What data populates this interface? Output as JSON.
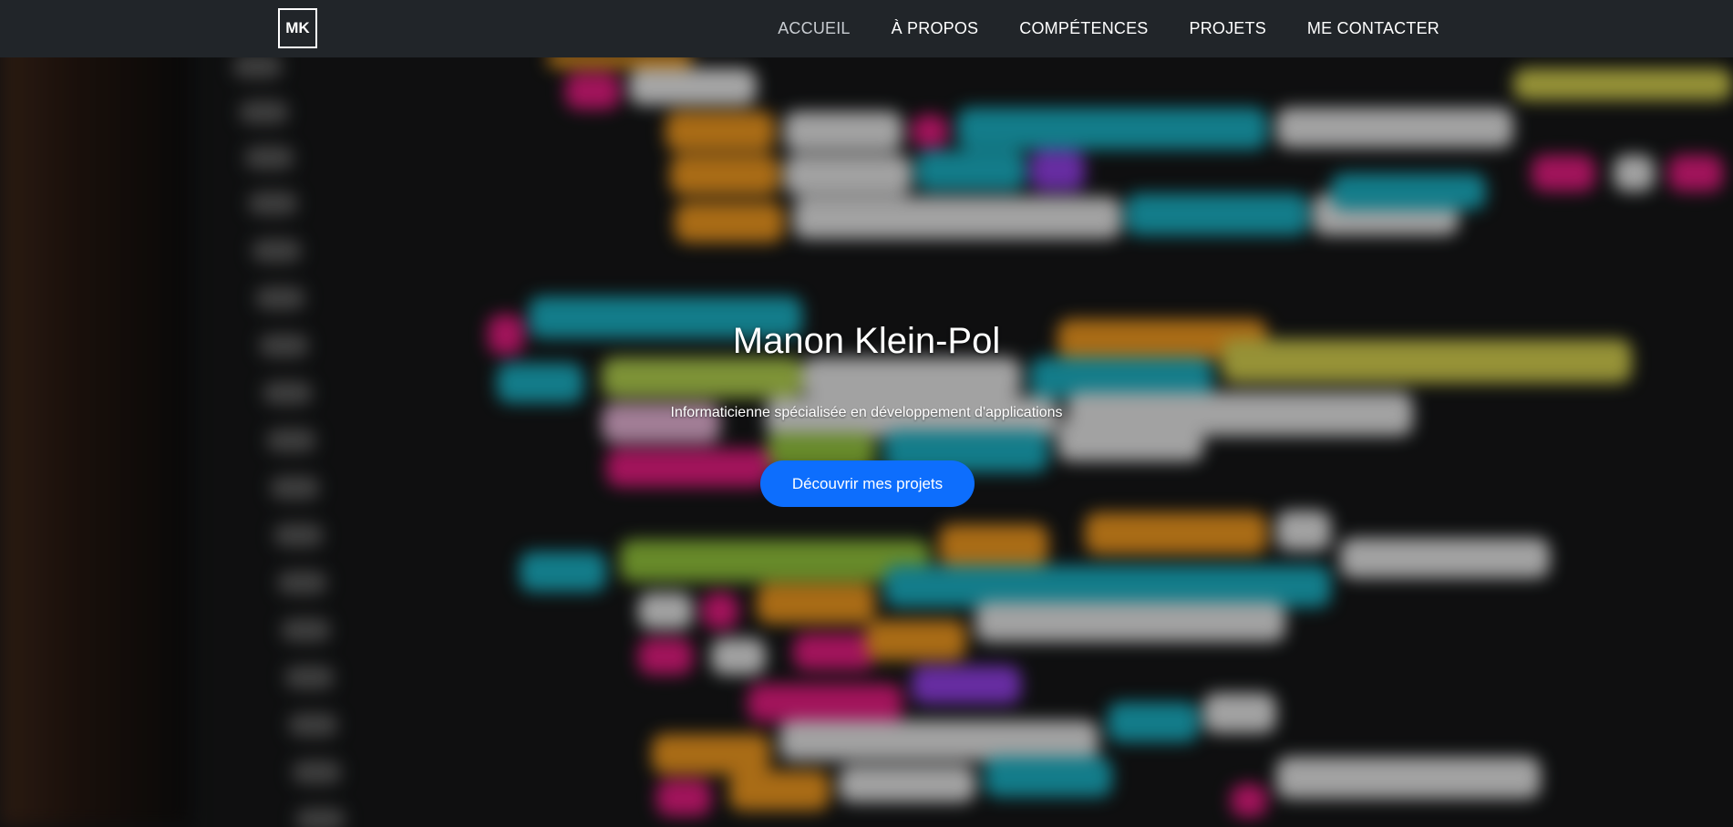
{
  "logo": {
    "text": "MK"
  },
  "nav": {
    "items": [
      {
        "label": "ACCUEIL",
        "active": true
      },
      {
        "label": "À PROPOS",
        "active": false
      },
      {
        "label": "COMPÉTENCES",
        "active": false
      },
      {
        "label": "PROJETS",
        "active": false
      },
      {
        "label": "ME CONTACTER",
        "active": false
      }
    ]
  },
  "hero": {
    "title": "Manon Klein-Pol",
    "subtitle": "Informaticienne spécialisée en développement d'applications",
    "cta_label": "Découvrir mes projets"
  },
  "colors": {
    "navbar": "#212529",
    "cta": "#0d6efd",
    "text": "#ffffff",
    "nav_active": "#c8ccd1"
  }
}
